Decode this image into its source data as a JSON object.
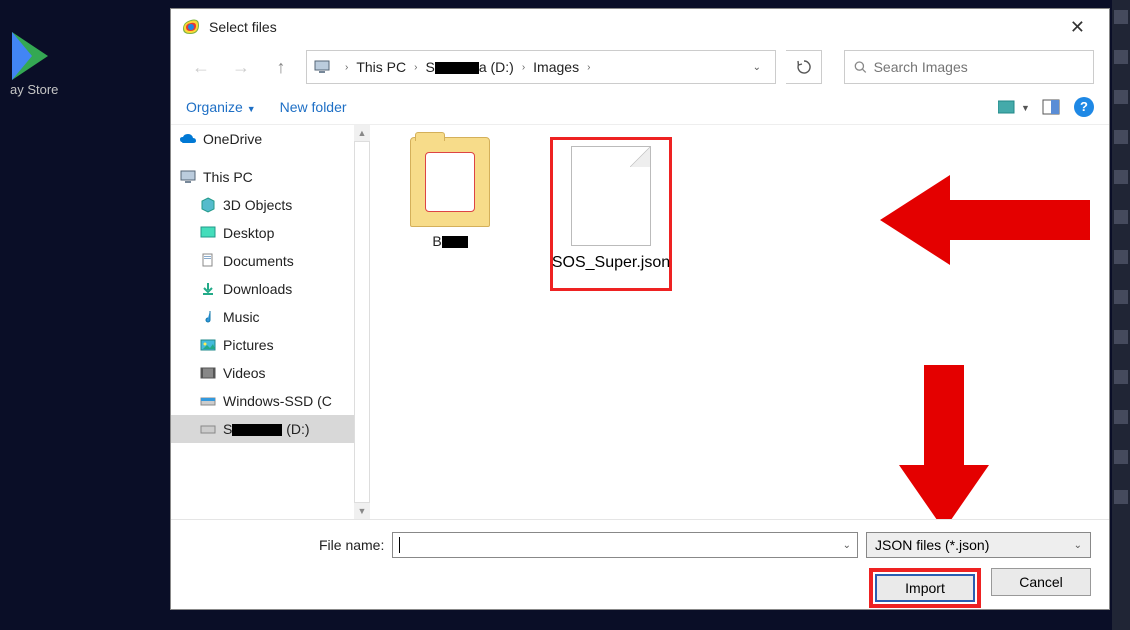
{
  "background": {
    "play_store_label": "ay Store"
  },
  "dialog": {
    "title": "Select files",
    "breadcrumbs": [
      "This PC",
      "S████a (D:)",
      "Images"
    ],
    "search_placeholder": "Search Images",
    "toolbar": {
      "organize": "Organize",
      "new_folder": "New folder"
    },
    "sidebar": {
      "onedrive": "OneDrive",
      "thispc": "This PC",
      "items": [
        {
          "label": "3D Objects"
        },
        {
          "label": "Desktop"
        },
        {
          "label": "Documents"
        },
        {
          "label": "Downloads"
        },
        {
          "label": "Music"
        },
        {
          "label": "Pictures"
        },
        {
          "label": "Videos"
        },
        {
          "label": "Windows-SSD (C"
        }
      ],
      "selected_prefix": "S",
      "selected_suffix": " (D:)"
    },
    "files": {
      "folder_prefix": "B",
      "json_name": "SOS_Super.json"
    },
    "footer": {
      "filename_label": "File name:",
      "filename_value": "",
      "filetype": "JSON files (*.json)",
      "import": "Import",
      "cancel": "Cancel"
    }
  }
}
